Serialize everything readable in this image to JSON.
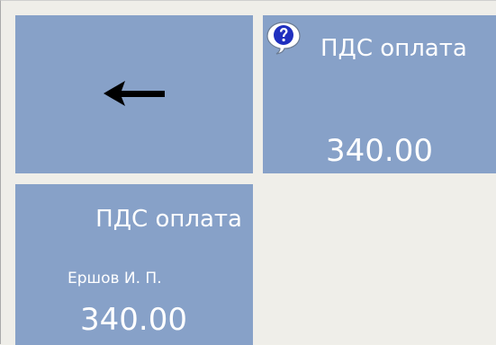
{
  "tiles": {
    "back": {
      "icon": "left-arrow-icon"
    },
    "pds_payment": {
      "icon": "help-question-icon",
      "title": "ПДС оплата",
      "amount": "340.00"
    },
    "pds_payment_person": {
      "title": "ПДС оплата",
      "person": "Ершов И. П.",
      "amount": "340.00"
    }
  },
  "colors": {
    "tile_bg": "#87a1c8",
    "page_bg": "#efeee9",
    "text": "#ffffff"
  }
}
